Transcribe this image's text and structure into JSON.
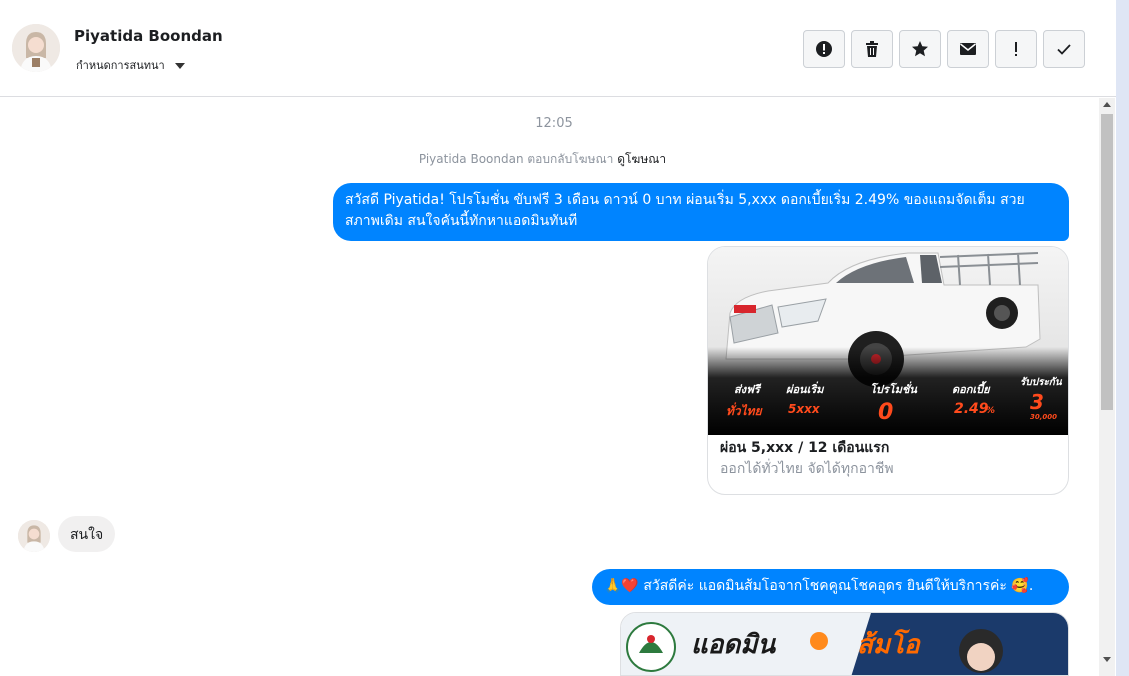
{
  "header": {
    "contact_name": "Piyatida Boondan",
    "conversation_setting": "กำหนดการสนทนา",
    "toolbar": [
      "report-icon",
      "trash-icon",
      "star-icon",
      "envelope-icon",
      "exclamation-icon",
      "check-icon"
    ]
  },
  "messages": {
    "timestamp": "12:05",
    "ad_reply_text": "Piyatida Boondan ตอบกลับโฆษณา",
    "ad_reply_link": "ดูโฆษณา",
    "outgoing_1": "สวัสดี Piyatida! โปรโมชั่น ขับฟรี 3 เดือน ดาวน์ 0 บาท ผ่อนเริ่ม 5,xxx  ดอกเบี้ยเริ่ม 2.49% ของแถมจัดเต็ม สวยสภาพเดิม สนใจคันนี้ทักหาแอดมินทันที",
    "card": {
      "title": "ผ่อน 5,xxx / 12 เดือนแรก",
      "subtitle": "ออกได้ทั่วไทย จัดได้ทุกอาชีพ",
      "image": {
        "label_1": "ส่งฟรี",
        "value_1": "ทั่วไทย",
        "label_2": "ผ่อนเริ่ม",
        "value_2": "5xxx",
        "label_3": "โปรโมชั่น",
        "value_3": "0",
        "label_4": "ดอกเบี้ย",
        "value_4": "2.49",
        "value_4_unit": "%",
        "label_5": "รับประกัน",
        "value_5": "3",
        "value_5_sub": "30,000"
      }
    },
    "incoming_1": "สนใจ",
    "outgoing_2": "สวัสดีค่ะ แอดมินส้มโอจากโชคคูณโชคอุดร ยินดีให้บริการค่ะ",
    "outgoing_2_prefix_emoji": "🙏❤️",
    "outgoing_2_suffix_emoji": "🥰.",
    "banner": {
      "text_1": "แอดมิน",
      "text_2": "ส้มโอ"
    }
  },
  "colors": {
    "accent": "#0084ff",
    "promo_orange": "#ff4a1c",
    "incoming_bubble": "#f1f0f0"
  }
}
